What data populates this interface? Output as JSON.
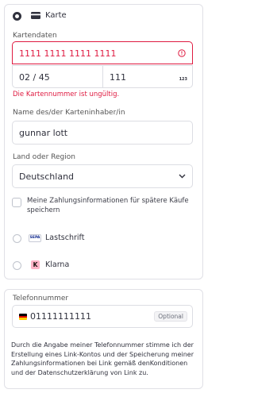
{
  "payment": {
    "card_option_label": "Karte",
    "card_data_label": "Kartendaten",
    "card_number": "1111 1111 1111 1111",
    "expiry": "02 / 45",
    "cvc": "111",
    "cvc_icon_text": "123",
    "card_error": "Die Kartennummer ist ungültig.",
    "holder_label": "Name des/der Karteninhaber/in",
    "holder_value": "gunnar lott",
    "country_label": "Land oder Region",
    "country_value": "Deutschland",
    "save_checkbox_label": "Meine Zahlungsinformationen für spätere Käufe speichern",
    "sepa_logo_text": "SEPA",
    "lastschrift_label": "Lastschrift",
    "klarna_logo_text": "K",
    "klarna_label": "Klarna"
  },
  "phone": {
    "label": "Telefonnummer",
    "value": "01111111111",
    "optional_badge": "Optional",
    "disclaimer": "Durch die Angabe meiner Telefonnummer stimme ich der Erstellung eines Link-Kontos und der Speicherung meiner Zahlungsinformationen bei Link gemäß denKonditionen und der Datenschutzerklärung von Link zu."
  },
  "colors": {
    "error": "#df1b41",
    "klarna_pink": "#ffb3c7",
    "sepa_blue": "#10298e"
  }
}
